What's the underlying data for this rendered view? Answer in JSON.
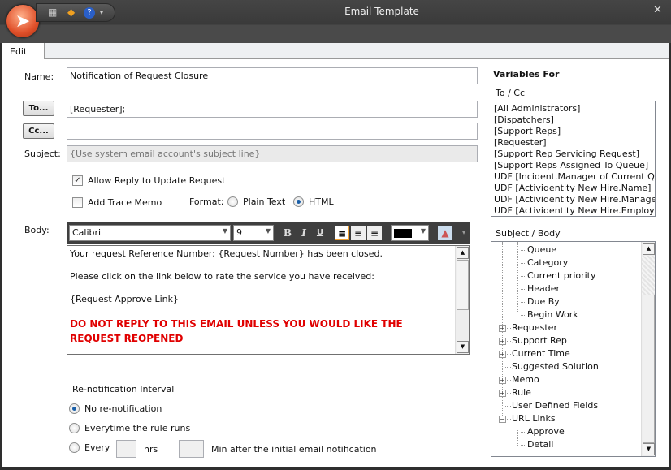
{
  "window": {
    "title": "Email Template",
    "close": "✕"
  },
  "quick_access": {
    "icons": [
      "save-icon",
      "import-icon",
      "help-icon",
      "dropdown-icon"
    ]
  },
  "tabs": [
    {
      "label": "Edit"
    }
  ],
  "form": {
    "name_label": "Name:",
    "name_value": "Notification of Request Closure",
    "to_button": "To...",
    "to_value": "[Requester];",
    "cc_button": "Cc...",
    "cc_value": "",
    "subject_label": "Subject:",
    "subject_placeholder": "{Use system email account's subject line}",
    "allow_reply_label": "Allow Reply to Update Request",
    "allow_reply_checked": true,
    "trace_memo_label": "Add Trace Memo",
    "trace_memo_checked": false,
    "format_label": "Format:",
    "format_options": [
      "Plain Text",
      "HTML"
    ],
    "format_selected": "HTML",
    "body_label": "Body:"
  },
  "toolbar": {
    "font": "Calibri",
    "size": "9",
    "bold": "B",
    "italic": "I",
    "underline": "U",
    "text_color": "#000000"
  },
  "body": {
    "line1": "Your request Reference Number: {Request Number} has been closed.",
    "line2": "Please click on the link below to rate the service you have received:",
    "line3": "{Request Approve Link}",
    "warning": "DO NOT REPLY TO THIS EMAIL UNLESS YOU WOULD LIKE THE REQUEST REOPENED",
    "warning_color": "#e00000"
  },
  "renotify": {
    "title": "Re-notification Interval",
    "options": [
      "No re-notification",
      "Everytime the rule runs",
      "Every"
    ],
    "selected": "No re-notification",
    "hrs_label": "hrs",
    "min_label": "Min after the initial email notification",
    "hrs_value": "",
    "min_value": ""
  },
  "variables": {
    "title": "Variables For",
    "to_cc_label": "To / Cc",
    "to_cc_items": [
      "[All Administrators]",
      "[Dispatchers]",
      "[Support Reps]",
      "[Requester]",
      "[Support Rep Servicing Request]",
      "[Support Reps Assigned To Queue]",
      "UDF [Incident.Manager of Current Queue]",
      "UDF [Actividentity New Hire.Name]",
      "UDF [Actividentity New Hire.Manager]",
      "UDF [Actividentity New Hire.Employee]"
    ],
    "subject_body_label": "Subject / Body",
    "tree": [
      {
        "label": "Queue",
        "level": 2
      },
      {
        "label": "Category",
        "level": 2
      },
      {
        "label": "Current priority",
        "level": 2
      },
      {
        "label": "Header",
        "level": 2
      },
      {
        "label": "Due By",
        "level": 2
      },
      {
        "label": "Begin Work",
        "level": 2
      },
      {
        "label": "Requester",
        "level": 1,
        "expander": "+"
      },
      {
        "label": "Support Rep",
        "level": 1,
        "expander": "+"
      },
      {
        "label": "Current Time",
        "level": 1,
        "expander": "+"
      },
      {
        "label": "Suggested Solution",
        "level": 1
      },
      {
        "label": "Memo",
        "level": 1,
        "expander": "+"
      },
      {
        "label": "Rule",
        "level": 1,
        "expander": "+"
      },
      {
        "label": "User Defined Fields",
        "level": 1
      },
      {
        "label": "URL Links",
        "level": 1,
        "expander": "-"
      },
      {
        "label": "Approve",
        "level": 2
      },
      {
        "label": "Detail",
        "level": 2
      }
    ]
  }
}
